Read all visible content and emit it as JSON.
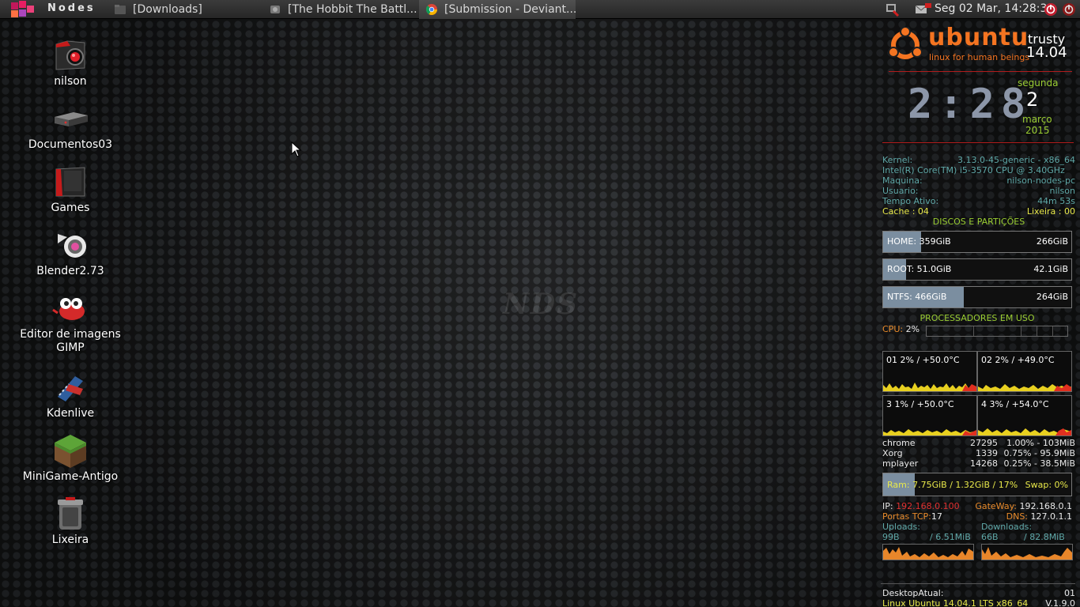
{
  "panel": {
    "menu_label": "Nodes",
    "tasks": [
      {
        "label": "[Downloads]",
        "icon": "folder-icon"
      },
      {
        "label": "[The Hobbit The Battl...",
        "icon": "media-player-icon"
      },
      {
        "label": "[Submission - Deviant...",
        "icon": "chrome-icon"
      }
    ],
    "clock": "Seg 02 Mar, 14:28:38"
  },
  "desktop": {
    "watermark": "NDS",
    "icons": [
      {
        "label": "nilson",
        "icon": "home-folder-icon"
      },
      {
        "label": "Documentos03",
        "icon": "drive-icon"
      },
      {
        "label": "Games",
        "icon": "folder-icon"
      },
      {
        "label": "Blender2.73",
        "icon": "blender-icon"
      },
      {
        "label": "Editor de imagens GIMP",
        "icon": "gimp-icon"
      },
      {
        "label": "Kdenlive",
        "icon": "kdenlive-icon"
      },
      {
        "label": "MiniGame-Antigo",
        "icon": "minecraft-icon"
      },
      {
        "label": "Lixeira",
        "icon": "trash-icon"
      }
    ]
  },
  "conky": {
    "logo": {
      "brand": "ubuntu",
      "tagline": "linux for human beings",
      "codename": "trusty",
      "version": "14.04"
    },
    "clock": {
      "time": "2:28",
      "weekday": "segunda",
      "day": "2",
      "month": "março",
      "year": "2015"
    },
    "sysinfo": {
      "kernel_label": "Kernel:",
      "kernel_value": "3.13.0-45-generic - x86_64",
      "cpu_model": "Intel(R) Core(TM) i5-3570 CPU @ 3.40GHz",
      "host_label": "Maquina:",
      "host_value": "nilson-nodes-pc",
      "user_label": "Usuario:",
      "user_value": "nilson",
      "uptime_label": "Tempo Ativo:",
      "uptime_value": "44m 53s",
      "cache": "Cache : 04",
      "trash": "Lixeira : 00"
    },
    "disks_title": "DISCOS E PARTIÇÕES",
    "disks": [
      {
        "label": "HOME: 359GiB",
        "free": "266GiB",
        "used_fraction": 0.2
      },
      {
        "label": "ROOT: 51.0GiB",
        "free": "42.1GiB",
        "used_fraction": 0.12
      },
      {
        "label": "NTFS: 466GiB",
        "free": "264GiB",
        "used_fraction": 0.43
      }
    ],
    "cpu_title": "PROCESSADORES EM USO",
    "cpu_label": "CPU:",
    "cpu_value": "2%",
    "cores": [
      {
        "label": "01 2% / +50.0°C"
      },
      {
        "label": "02 2% / +49.0°C"
      },
      {
        "label": "3 1% / +50.0°C"
      },
      {
        "label": "4 3% / +54.0°C"
      }
    ],
    "processes": [
      {
        "name": "chrome",
        "pid": "27295",
        "usage": "1.00% - 103MiB"
      },
      {
        "name": "Xorg",
        "pid": "1339",
        "usage": "0.75% - 95.9MiB"
      },
      {
        "name": "mplayer",
        "pid": "14268",
        "usage": "0.25% - 38.5MiB"
      }
    ],
    "ram": {
      "label": "Ram:",
      "value": "7.75GiB / 1.32GiB / 17%",
      "swap_label": "Swap:",
      "swap_value": "0%",
      "used_fraction": 0.17
    },
    "network": {
      "ip_label": "IP:",
      "ip_value": "192.168.0.100",
      "gateway_label": "GateWay:",
      "gateway_value": "192.168.0.1",
      "ports_label": "Portas TCP:",
      "ports_value": "17",
      "dns_label": "DNS:",
      "dns_value": "127.0.1.1",
      "uploads_label": "Uploads:",
      "uploads_value": "99B",
      "uploads_total": "/ 6.51MiB",
      "downloads_label": "Downloads:",
      "downloads_value": "66B",
      "downloads_total": "/ 82.8MiB"
    },
    "footer": {
      "desktop_label": "DesktopAtual:",
      "desktop_value": "01",
      "os": "Linux Ubuntu 14.04.1 LTS x86_64",
      "version": "V.1.9.0"
    }
  }
}
